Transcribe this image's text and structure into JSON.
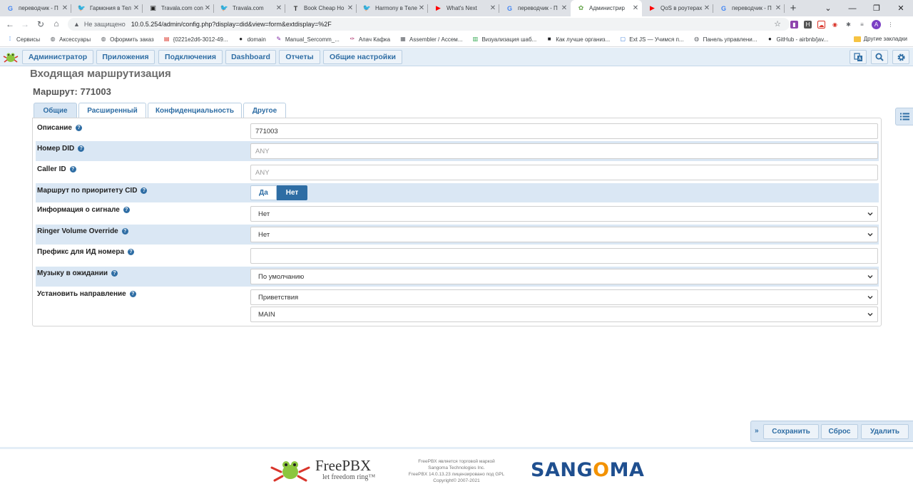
{
  "browser": {
    "tabs": [
      {
        "title": "переводчик - П",
        "icon": "google-icon",
        "color": "#4285f4",
        "glyph": "G"
      },
      {
        "title": "Гармония в Тел",
        "icon": "twitter-icon",
        "color": "#1da1f2",
        "glyph": "🐦"
      },
      {
        "title": "Travala.com con",
        "icon": "travala-icon",
        "color": "#222222",
        "glyph": "▣"
      },
      {
        "title": "Travala.com",
        "icon": "twitter-icon",
        "color": "#1da1f2",
        "glyph": "🐦"
      },
      {
        "title": "Book Cheap Ho",
        "icon": "travala-t-icon",
        "color": "#333333",
        "glyph": "T"
      },
      {
        "title": "Harmony в Теле",
        "icon": "twitter-icon",
        "color": "#1da1f2",
        "glyph": "🐦"
      },
      {
        "title": "What's Next",
        "icon": "youtube-icon",
        "color": "#ff0000",
        "glyph": "▶"
      },
      {
        "title": "переводчик - П",
        "icon": "google-icon",
        "color": "#4285f4",
        "glyph": "G"
      },
      {
        "title": "Администрир",
        "icon": "freepbx-icon",
        "color": "#6aa84f",
        "glyph": "✿"
      },
      {
        "title": "QoS в роутерах",
        "icon": "youtube-icon",
        "color": "#ff0000",
        "glyph": "▶"
      },
      {
        "title": "переводчик - П",
        "icon": "google-icon",
        "color": "#4285f4",
        "glyph": "G"
      }
    ],
    "active_tab": 8,
    "window_controls": {
      "minimize": "—",
      "restore": "❐",
      "close": "✕",
      "menu": "⌄"
    },
    "new_tab": "+",
    "address": {
      "security_label": "Не защищено",
      "url": "10.0.5.254/admin/config.php?display=did&view=form&extdisplay=%2F"
    },
    "profile_initial": "A",
    "bookmarks": [
      {
        "label": "Сервисы",
        "icon": "apps-icon",
        "color": "#1a73e8",
        "glyph": "⁞"
      },
      {
        "label": "Аксессуары",
        "icon": "globe-icon",
        "color": "#5f6368",
        "glyph": "◍"
      },
      {
        "label": "Оформить заказ",
        "icon": "globe-icon",
        "color": "#5f6368",
        "glyph": "◍"
      },
      {
        "label": "{0221e2d6-3012-49...",
        "icon": "doc-icon",
        "color": "#d93025",
        "glyph": "▤"
      },
      {
        "label": "domain",
        "icon": "user-icon",
        "color": "#202124",
        "glyph": "●"
      },
      {
        "label": "Manual_Sercomm_...",
        "icon": "pen-icon",
        "color": "#7b1fa2",
        "glyph": "✎"
      },
      {
        "label": "Апач Кафка",
        "icon": "feather-icon",
        "color": "#a61c5c",
        "glyph": "✑"
      },
      {
        "label": "Assembler / Ассем...",
        "icon": "grid-icon",
        "color": "#5f6368",
        "glyph": "▦"
      },
      {
        "label": "Визуализация шаб...",
        "icon": "chart-icon",
        "color": "#34a853",
        "glyph": "▥"
      },
      {
        "label": "Как лучше организ...",
        "icon": "square-icon",
        "color": "#202124",
        "glyph": "■"
      },
      {
        "label": "Ext JS — Учимся п...",
        "icon": "ext-icon",
        "color": "#3b7dd8",
        "glyph": "▢"
      },
      {
        "label": "Панель управлени...",
        "icon": "globe-icon",
        "color": "#5f6368",
        "glyph": "◍"
      },
      {
        "label": "GitHub - airbnb/jav...",
        "icon": "github-icon",
        "color": "#202124",
        "glyph": "●"
      }
    ],
    "other_bookmarks": "Другие закладки"
  },
  "app": {
    "menu": [
      {
        "label": "Администратор"
      },
      {
        "label": "Приложения"
      },
      {
        "label": "Подключения"
      },
      {
        "label": "Dashboard"
      },
      {
        "label": "Отчеты"
      },
      {
        "label": "Общие настройки"
      }
    ],
    "page_title": "Входящая маршрутизация",
    "route_title": "Маршрут: 771003",
    "tabs": [
      {
        "label": "Общие"
      },
      {
        "label": "Расширенный"
      },
      {
        "label": "Конфиденциальность"
      },
      {
        "label": "Другое"
      }
    ],
    "active_tab": 0,
    "form": {
      "description": {
        "label": "Описание",
        "value": "771003"
      },
      "did_number": {
        "label": "Номер DID",
        "placeholder": "ANY"
      },
      "caller_id": {
        "label": "Caller ID",
        "placeholder": "ANY"
      },
      "cid_priority": {
        "label": "Маршрут по приоритету CID",
        "yes": "Да",
        "no": "Нет",
        "selected": "Нет"
      },
      "alert_info": {
        "label": "Информация о сигнале",
        "value": "Нет"
      },
      "ringer_volume": {
        "label": "Ringer Volume Override",
        "value": "Нет"
      },
      "cid_prefix": {
        "label": "Префикс для ИД номера",
        "value": ""
      },
      "music_on_hold": {
        "label": "Музыку в ожидании",
        "value": "По умолчанию"
      },
      "destination": {
        "label": "Установить направление",
        "value": "Приветствия",
        "sub_value": "MAIN"
      }
    },
    "actions": {
      "submit": "Сохранить",
      "reset": "Сброс",
      "delete": "Удалить",
      "expand": "»"
    },
    "footer": {
      "freepbx_name": "FreePBX",
      "freepbx_tagline": "let freedom ring™",
      "notice_lines": [
        "FreePBX является торговой маркой",
        "Sangoma Technologies Inc.",
        "FreePBX 14.0.13.23 лицензировано под GPL",
        "Copyright© 2007-2021"
      ],
      "sangoma": "SANGOMA"
    },
    "colors": {
      "accent": "#2e6da4",
      "row_highlight": "#dae7f4",
      "nav_bg": "#e4eef7",
      "sangoma_blue": "#1f4f8f",
      "sangoma_orange": "#f39200"
    }
  }
}
